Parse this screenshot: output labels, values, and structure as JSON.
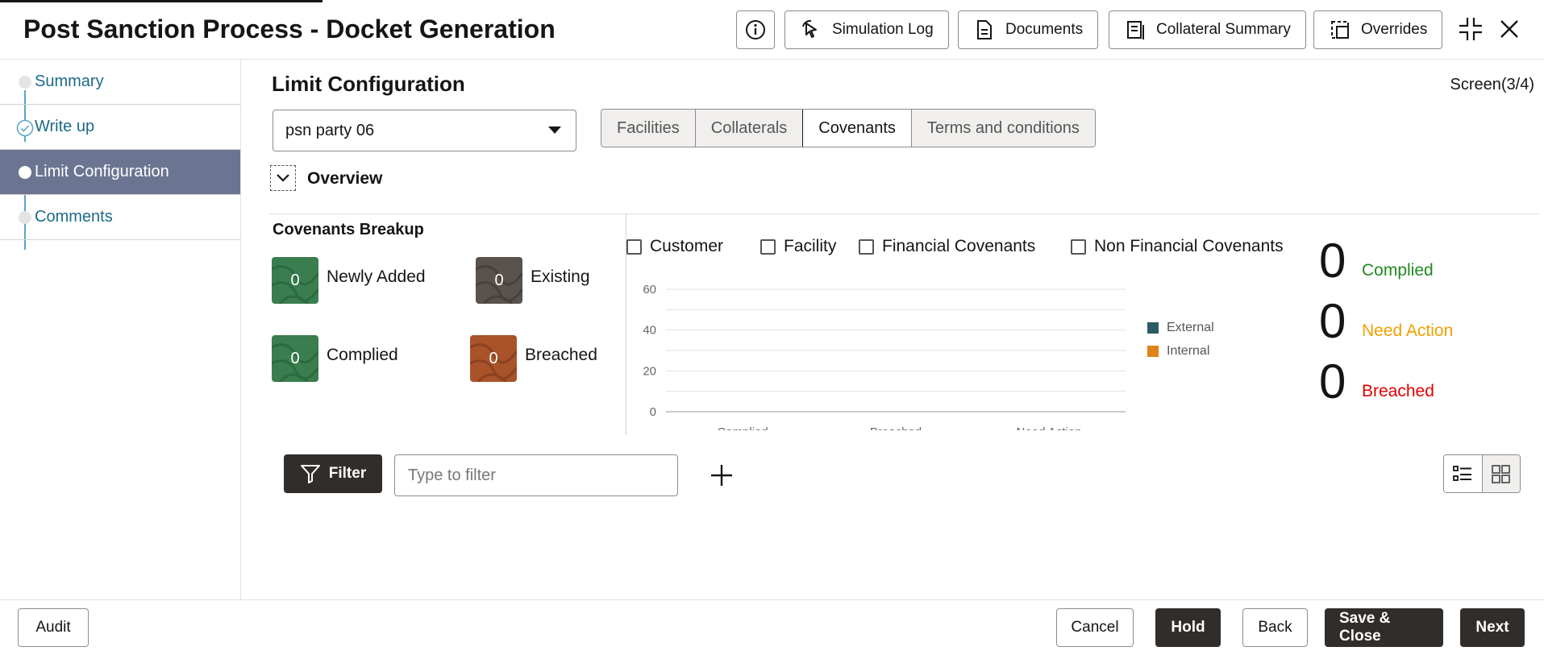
{
  "header": {
    "title": "Post Sanction Process - Docket Generation",
    "buttons": {
      "simulation_log": "Simulation Log",
      "documents": "Documents",
      "collateral_summary": "Collateral Summary",
      "overrides": "Overrides"
    }
  },
  "sidebar": {
    "items": [
      {
        "label": "Summary",
        "state": "default"
      },
      {
        "label": "Write up",
        "state": "completed"
      },
      {
        "label": "Limit Configuration",
        "state": "active"
      },
      {
        "label": "Comments",
        "state": "default"
      }
    ]
  },
  "main": {
    "title": "Limit Configuration",
    "screen_indicator": "Screen(3/4)",
    "party_select": {
      "value": "psn party 06"
    },
    "tabs": [
      {
        "label": "Facilities",
        "active": false
      },
      {
        "label": "Collaterals",
        "active": false
      },
      {
        "label": "Covenants",
        "active": true
      },
      {
        "label": "Terms and conditions",
        "active": false
      }
    ],
    "overview_label": "Overview",
    "breakup": {
      "title": "Covenants Breakup",
      "tiles": {
        "newly_added": {
          "label": "Newly Added",
          "count": "0",
          "color": "#3a7d4f"
        },
        "existing": {
          "label": "Existing",
          "count": "0",
          "color": "#5a524c"
        },
        "complied": {
          "label": "Complied",
          "count": "0",
          "color": "#3a7d4f"
        },
        "breached": {
          "label": "Breached",
          "count": "0",
          "color": "#a9532a"
        }
      }
    },
    "checkboxes": {
      "customer": "Customer",
      "facility": "Facility",
      "financial": "Financial Covenants",
      "non_financial": "Non Financial Covenants"
    },
    "stats": {
      "complied": {
        "value": "0",
        "label": "Complied",
        "color": "#1f8a20"
      },
      "need_action": {
        "value": "0",
        "label": "Need Action",
        "color": "#f2a000"
      },
      "breached": {
        "value": "0",
        "label": "Breached",
        "color": "#e00000"
      }
    },
    "filter": {
      "button_label": "Filter",
      "placeholder": "Type to filter"
    }
  },
  "chart_data": {
    "type": "bar",
    "categories": [
      "Complied",
      "Breached",
      "Need Action"
    ],
    "series": [
      {
        "name": "External",
        "values": [
          0,
          0,
          0
        ],
        "color": "#2e5b63"
      },
      {
        "name": "Internal",
        "values": [
          0,
          0,
          0
        ],
        "color": "#e0831a"
      }
    ],
    "yticks": [
      "0",
      "20",
      "40",
      "60"
    ],
    "ylim": [
      0,
      60
    ],
    "grid": true,
    "legend": "right"
  },
  "footer": {
    "audit": "Audit",
    "cancel": "Cancel",
    "hold": "Hold",
    "back": "Back",
    "save_close": "Save & Close",
    "next": "Next"
  }
}
